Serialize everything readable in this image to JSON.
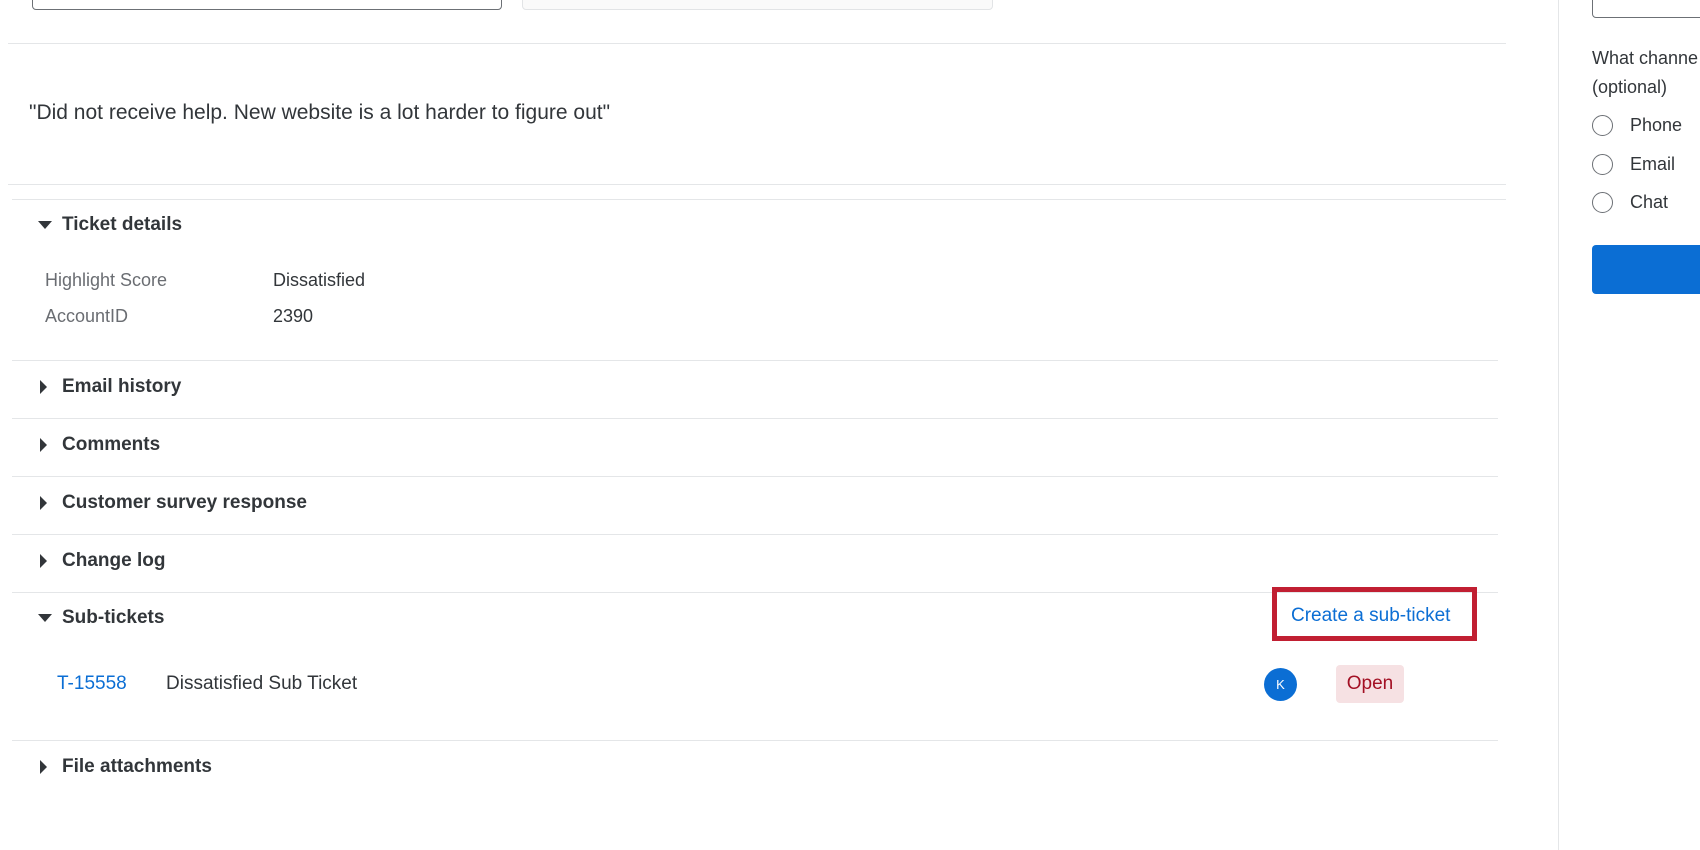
{
  "response": {
    "quote": "\"Did not receive help. New website is a lot harder to figure out\""
  },
  "sections": {
    "ticket_details": {
      "title": "Ticket details",
      "expanded": true,
      "fields": [
        {
          "label": "Highlight Score",
          "value": "Dissatisfied"
        },
        {
          "label": "AccountID",
          "value": "2390"
        }
      ]
    },
    "email_history": {
      "title": "Email history",
      "expanded": false
    },
    "comments": {
      "title": "Comments",
      "expanded": false
    },
    "customer_survey": {
      "title": "Customer survey response",
      "expanded": false
    },
    "change_log": {
      "title": "Change log",
      "expanded": false
    },
    "sub_tickets": {
      "title": "Sub-tickets",
      "expanded": true,
      "create_label": "Create a sub-ticket",
      "items": [
        {
          "id": "T-15558",
          "description": "Dissatisfied Sub Ticket",
          "assignee_initial": "K",
          "status": "Open"
        }
      ]
    },
    "file_attachments": {
      "title": "File attachments",
      "expanded": false
    }
  },
  "side_panel": {
    "question_line1": "What channe",
    "question_line2": "(optional)",
    "options": [
      "Phone",
      "Email",
      "Chat"
    ]
  },
  "colors": {
    "accent": "#0b6ed4",
    "highlight_box": "#c11f32",
    "status_open_bg": "#f6e1e3",
    "status_open_text": "#a31024"
  }
}
